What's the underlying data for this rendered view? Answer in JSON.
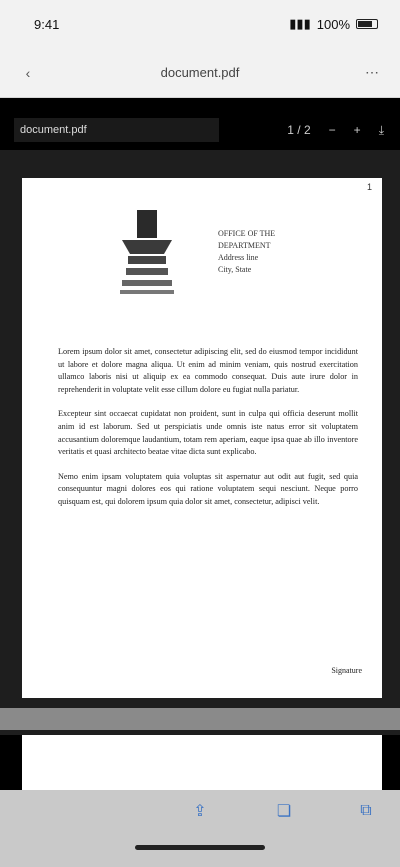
{
  "status": {
    "time": "9:41",
    "signal": "▮▮▮",
    "battery_label": "100%"
  },
  "browser": {
    "url": "document.pdf",
    "back_icon": "chevron-left-icon",
    "menu_icon": "menu-icon"
  },
  "viewer": {
    "title": "document.pdf",
    "page_indicator": "1 / 2",
    "controls": [
      "−",
      "+",
      "⤓"
    ]
  },
  "document": {
    "page_number": "1",
    "letterhead_lines": [
      "OFFICE OF THE",
      "DEPARTMENT",
      "Address line",
      "City, State"
    ],
    "paragraphs": [
      "Lorem ipsum dolor sit amet, consectetur adipiscing elit, sed do eiusmod tempor incididunt ut labore et dolore magna aliqua. Ut enim ad minim veniam, quis nostrud exercitation ullamco laboris nisi ut aliquip ex ea commodo consequat. Duis aute irure dolor in reprehenderit in voluptate velit esse cillum dolore eu fugiat nulla pariatur.",
      "Excepteur sint occaecat cupidatat non proident, sunt in culpa qui officia deserunt mollit anim id est laborum. Sed ut perspiciatis unde omnis iste natus error sit voluptatem accusantium doloremque laudantium, totam rem aperiam, eaque ipsa quae ab illo inventore veritatis et quasi architecto beatae vitae dicta sunt explicabo.",
      "Nemo enim ipsam voluptatem quia voluptas sit aspernatur aut odit aut fugit, sed quia consequuntur magni dolores eos qui ratione voluptatem sequi nesciunt. Neque porro quisquam est, qui dolorem ipsum quia dolor sit amet, consectetur, adipisci velit."
    ],
    "signature": "Signature"
  },
  "toolbar": {
    "buttons": [
      "share-icon",
      "book-icon",
      "tabs-icon"
    ]
  }
}
